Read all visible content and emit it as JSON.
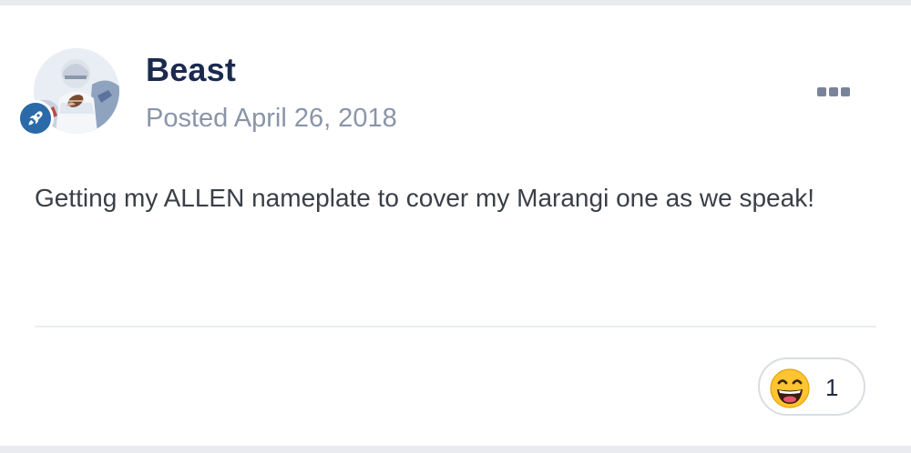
{
  "post": {
    "author": "Beast",
    "date": "Posted April 26, 2018",
    "body": "Getting my ALLEN nameplate to cover my Marangi one as we speak!",
    "more_icon": "ellipsis-icon",
    "rank_icon": "rocket-icon"
  },
  "reactions": {
    "emoji": "grinning-face-icon",
    "count": "1"
  },
  "colors": {
    "author": "#1b2a4e",
    "date": "#8a95a8",
    "badge": "#2b6aa8",
    "body": "#3a3f47"
  }
}
